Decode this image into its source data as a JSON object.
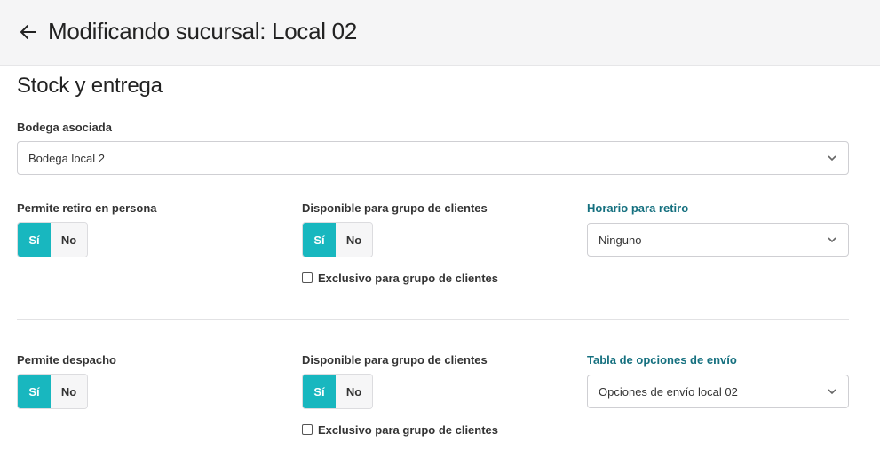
{
  "header": {
    "title": "Modificando sucursal: Local 02"
  },
  "section": {
    "title": "Stock y entrega"
  },
  "warehouse": {
    "label": "Bodega asociada",
    "value": "Bodega local 2"
  },
  "pickup": {
    "label": "Permite retiro en persona",
    "yes": "Sí",
    "no": "No",
    "selected": "yes",
    "group_label": "Disponible para grupo de clientes",
    "group_yes": "Sí",
    "group_no": "No",
    "group_selected": "yes",
    "exclusive_label": "Exclusivo para grupo de clientes",
    "exclusive_checked": false,
    "schedule_label": "Horario para retiro",
    "schedule_value": "Ninguno"
  },
  "delivery": {
    "label": "Permite despacho",
    "yes": "Sí",
    "no": "No",
    "selected": "yes",
    "group_label": "Disponible para grupo de clientes",
    "group_yes": "Sí",
    "group_no": "No",
    "group_selected": "yes",
    "exclusive_label": "Exclusivo para grupo de clientes",
    "exclusive_checked": false,
    "shipping_label": "Tabla de opciones de envío",
    "shipping_value": "Opciones de envío local 02"
  },
  "colors": {
    "accent": "#18b7bf",
    "link": "#15707f",
    "header_bg": "#f5f5f6"
  }
}
